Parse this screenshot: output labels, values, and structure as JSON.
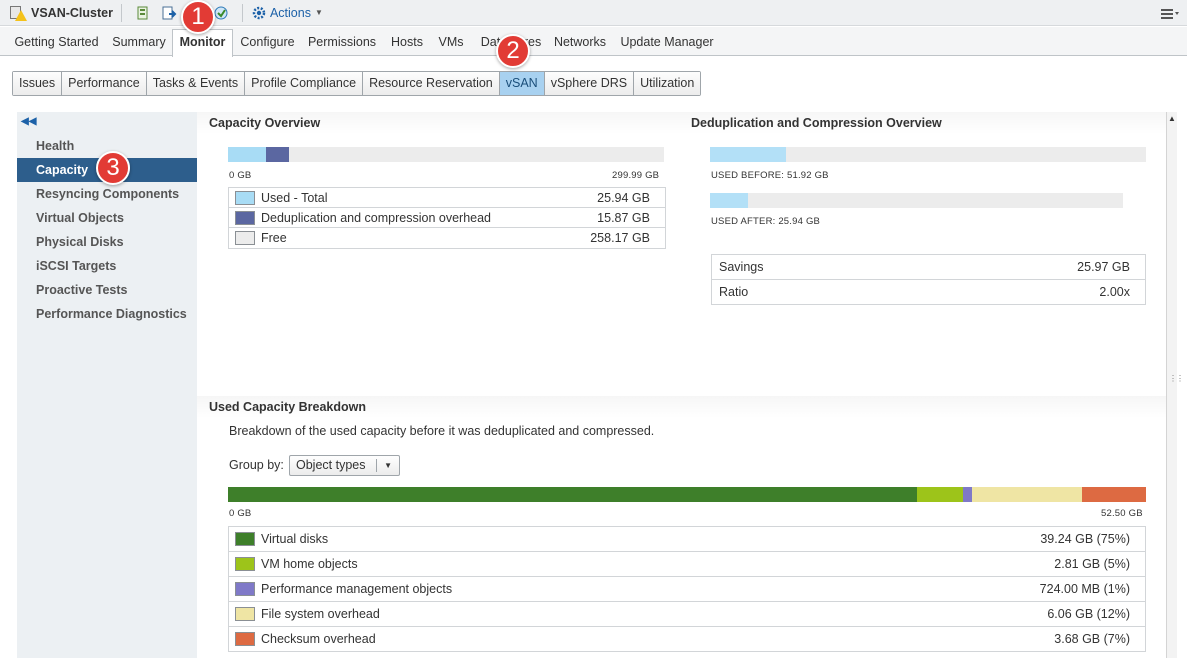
{
  "toolbar": {
    "title": "VSAN-Cluster",
    "actions_label": "Actions",
    "icons": [
      "cluster-warning-icon",
      "add-host-icon",
      "move-in-icon",
      "new-vm-icon",
      "deploy-ovf-icon",
      "actions-gear-icon",
      "menu-icon"
    ]
  },
  "main_tabs": [
    "Getting Started",
    "Summary",
    "Monitor",
    "Configure",
    "Permissions",
    "Hosts",
    "VMs",
    "Datastores",
    "Networks",
    "Update Manager"
  ],
  "main_tab_active": "Monitor",
  "sub_tabs": [
    "Issues",
    "Performance",
    "Tasks & Events",
    "Profile Compliance",
    "Resource Reservation",
    "vSAN",
    "vSphere DRS",
    "Utilization"
  ],
  "sub_tab_active": "vSAN",
  "left_nav": {
    "items": [
      "Health",
      "Capacity",
      "Resyncing Components",
      "Virtual Objects",
      "Physical Disks",
      "iSCSI Targets",
      "Proactive Tests",
      "Performance Diagnostics"
    ],
    "active": "Capacity"
  },
  "capacity_overview": {
    "title": "Capacity Overview",
    "axis_min": "0 GB",
    "axis_max": "299.99 GB",
    "total_gb": 299.99,
    "rows": [
      {
        "label": "Used - Total",
        "value": "25.94 GB",
        "gb": 25.94,
        "color": "#a8dcf5"
      },
      {
        "label": "Deduplication and compression overhead",
        "value": "15.87 GB",
        "gb": 15.87,
        "color": "#5b67a1"
      },
      {
        "label": "Free",
        "value": "258.17 GB",
        "gb": 258.17,
        "color": "#ececec"
      }
    ]
  },
  "dedup_overview": {
    "title": "Deduplication and Compression Overview",
    "used_before_label": "USED BEFORE: 51.92 GB",
    "used_before_gb": 51.92,
    "used_after_label": "USED AFTER: 25.94 GB",
    "used_after_gb": 25.94,
    "bar_color": "#b3e0f7",
    "rows": [
      {
        "label": "Savings",
        "value": "25.97 GB"
      },
      {
        "label": "Ratio",
        "value": "2.00x"
      }
    ]
  },
  "used_breakdown": {
    "title": "Used Capacity Breakdown",
    "description": "Breakdown of the used capacity before it was deduplicated and compressed.",
    "group_by_label": "Group by:",
    "group_by_value": "Object types",
    "axis_min": "0 GB",
    "axis_max": "52.50 GB",
    "rows": [
      {
        "label": "Virtual disks",
        "value": "39.24 GB (75%)",
        "percent": 75,
        "color": "#3e7f2a"
      },
      {
        "label": "VM home objects",
        "value": "2.81 GB (5%)",
        "percent": 5,
        "color": "#9dc41a"
      },
      {
        "label": "Performance management objects",
        "value": "724.00 MB (1%)",
        "percent": 1,
        "color": "#7f79c8"
      },
      {
        "label": "File system overhead",
        "value": "6.06 GB (12%)",
        "percent": 12,
        "color": "#efe5a4"
      },
      {
        "label": "Checksum overhead",
        "value": "3.68 GB (7%)",
        "percent": 7,
        "color": "#dd6a42"
      }
    ]
  },
  "callouts": [
    "1",
    "2",
    "3"
  ]
}
